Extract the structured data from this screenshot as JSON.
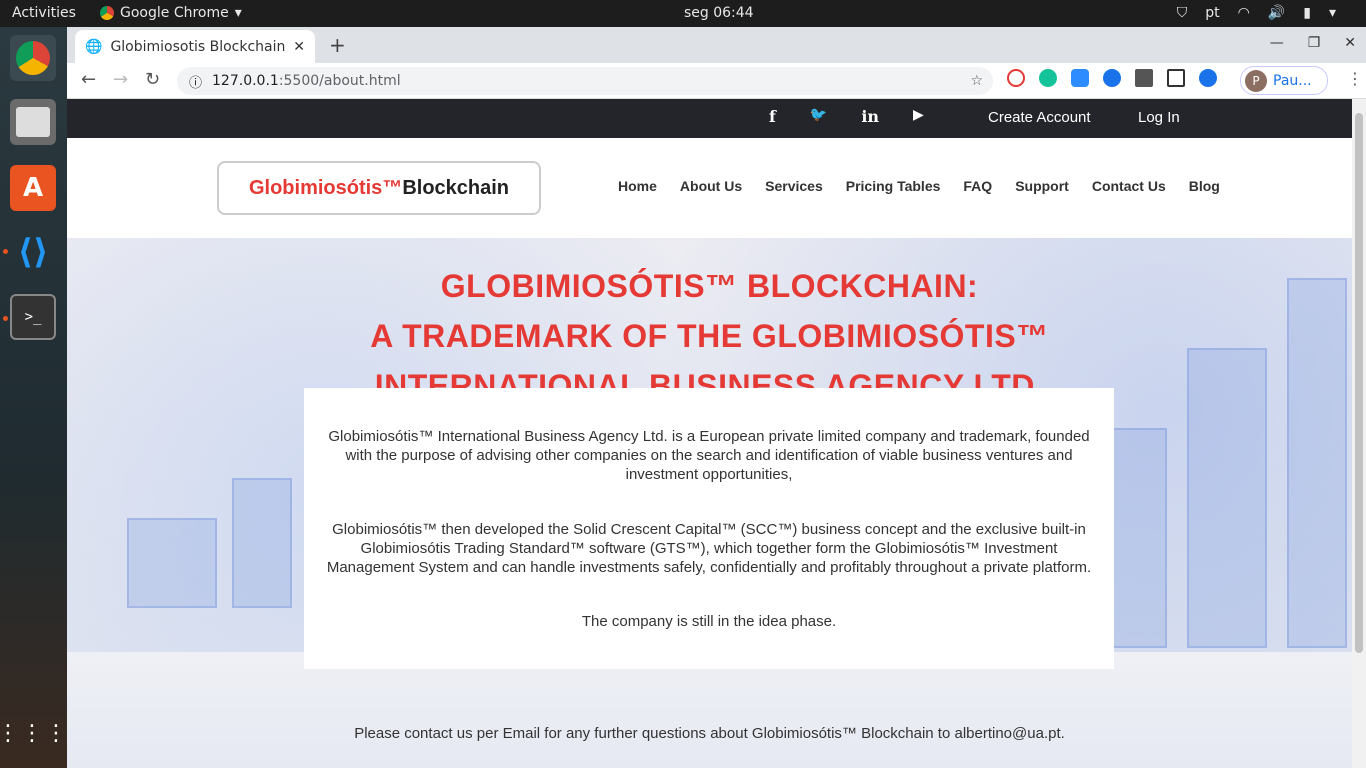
{
  "system": {
    "activities": "Activities",
    "app_name": "Google Chrome",
    "clock": "seg 06:44",
    "lang": "pt"
  },
  "browser": {
    "tab_title": "Globimiosotis Blockchain",
    "url_host": "127.0.0.1",
    "url_path": ":5500/about.html",
    "profile_name": "Pau...",
    "profile_initial": "P"
  },
  "social_bar": {
    "facebook": "f",
    "twitter": "🐦",
    "linkedin": "in",
    "youtube": "▶",
    "create_account": "Create Account",
    "login": "Log In"
  },
  "logo": {
    "red": "Globimiosótis™",
    "black": "Blockchain"
  },
  "menu": [
    "Home",
    "About Us",
    "Services",
    "Pricing Tables",
    "FAQ",
    "Support",
    "Contact Us",
    "Blog"
  ],
  "hero": {
    "line1": "GLOBIMIOSÓTIS™ BLOCKCHAIN:",
    "line2": "A TRADEMARK OF THE GLOBIMIOSÓTIS™",
    "line3": "INTERNATIONAL BUSINESS AGENCY LTD."
  },
  "about": {
    "p1": "Globimiosótis™ International Business Agency Ltd. is a European private limited company and trademark, founded with the purpose of advising other companies on the search and identification of viable business ventures and investment opportunities,",
    "p2": "Globimiosótis™ then developed the Solid Crescent Capital™ (SCC™) business concept and the exclusive built-in Globimiosótis Trading Standard™ software (GTS™), which together form the Globimiosótis™ Investment Management System and can handle investments safely, confidentially and profitably throughout a private platform.",
    "p3": "The company is still in the idea phase."
  },
  "contact": "Please contact us per Email for any further questions about Globimiosótis™ Blockchain to albertino@ua.pt.",
  "colors": {
    "accent_red": "#e53935",
    "dark_bar": "#23252b"
  }
}
